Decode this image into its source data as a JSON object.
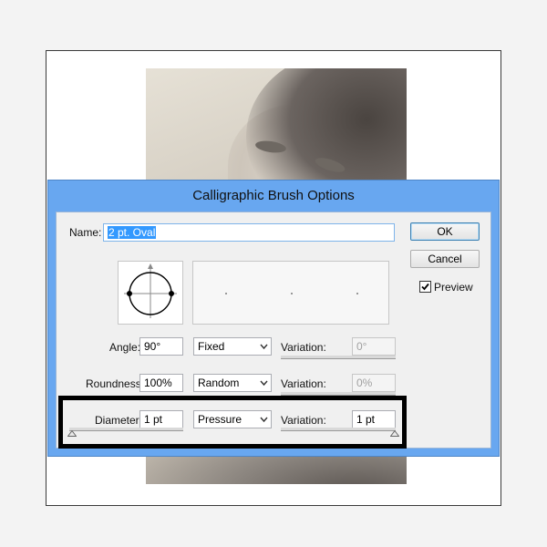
{
  "dialog": {
    "title": "Calligraphic Brush Options",
    "name_label": "Name:",
    "name_value": "2 pt. Oval",
    "ok_label": "OK",
    "cancel_label": "Cancel",
    "preview_label": "Preview",
    "preview_checked": true
  },
  "angle": {
    "label": "Angle:",
    "value": "90°",
    "mode": "Fixed",
    "variation_label": "Variation:",
    "variation_value": "0°"
  },
  "roundness": {
    "label": "Roundness:",
    "value": "100%",
    "mode": "Random",
    "variation_label": "Variation:",
    "variation_value": "0%"
  },
  "diameter": {
    "label": "Diameter:",
    "value": "1 pt",
    "mode": "Pressure",
    "variation_label": "Variation:",
    "variation_value": "1 pt"
  },
  "colors": {
    "title_bar": "#68a7f0",
    "selection": "#3399ff",
    "client": "#f0f0f0",
    "highlight_border": "#000000"
  },
  "icons": {
    "check": "checkmark-icon",
    "dropdown": "chevron-down-icon",
    "slider": "triangle-thumb-icon"
  }
}
